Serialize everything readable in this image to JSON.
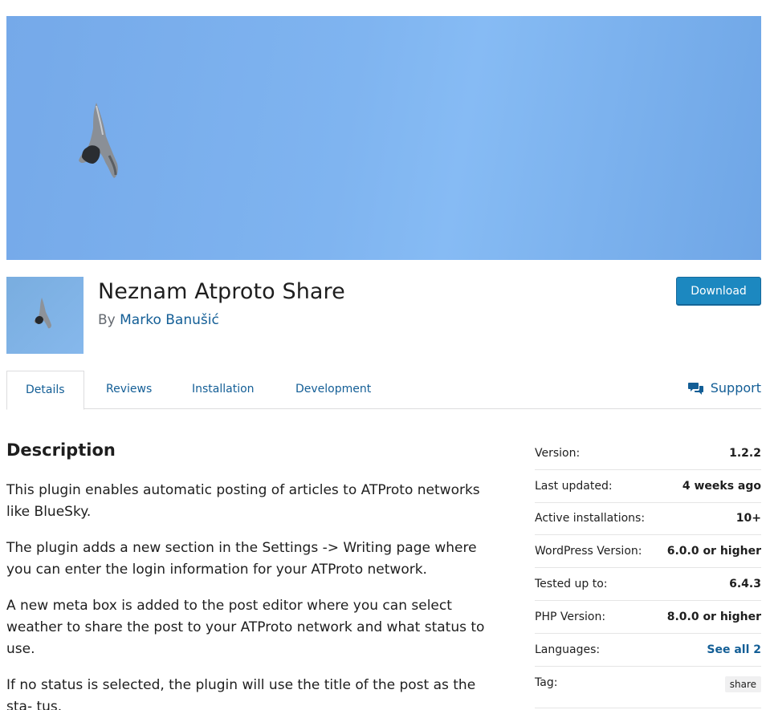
{
  "plugin": {
    "title": "Neznam Atproto Share",
    "by_prefix": "By",
    "author": "Marko Banušić",
    "download_label": "Download"
  },
  "tabs": [
    {
      "label": "Details",
      "active": true
    },
    {
      "label": "Reviews",
      "active": false
    },
    {
      "label": "Installation",
      "active": false
    },
    {
      "label": "Development",
      "active": false
    }
  ],
  "support_label": "Support",
  "description": {
    "title": "Description",
    "paragraphs": [
      "This plugin enables automatic posting of articles to ATProto networks like BlueSky.",
      "The plugin adds a new section in the Settings -> Writing page where you can enter the login information for your ATProto network.",
      "A new meta box is added to the post editor where you can select weather to share the post to your ATProto network and what status to use.",
      "If no status is selected, the plugin will use the title of the post as the sta- tus."
    ]
  },
  "meta": {
    "version": {
      "label": "Version:",
      "value": "1.2.2"
    },
    "last_updated": {
      "label": "Last updated:",
      "value": "4 weeks ago"
    },
    "active_installs": {
      "label": "Active installations:",
      "value": "10+"
    },
    "wp_version": {
      "label": "WordPress Version:",
      "value": "6.0.0 or higher"
    },
    "tested_up_to": {
      "label": "Tested up to:",
      "value": "6.4.3"
    },
    "php_version": {
      "label": "PHP Version:",
      "value": "8.0.0 or higher"
    },
    "languages": {
      "label": "Languages:",
      "value": "See all 2"
    },
    "tag": {
      "label": "Tag:",
      "value": "share"
    }
  },
  "colors": {
    "link": "#135e96",
    "button": "#1c88c0",
    "banner_sky": "#7fb4f0"
  }
}
